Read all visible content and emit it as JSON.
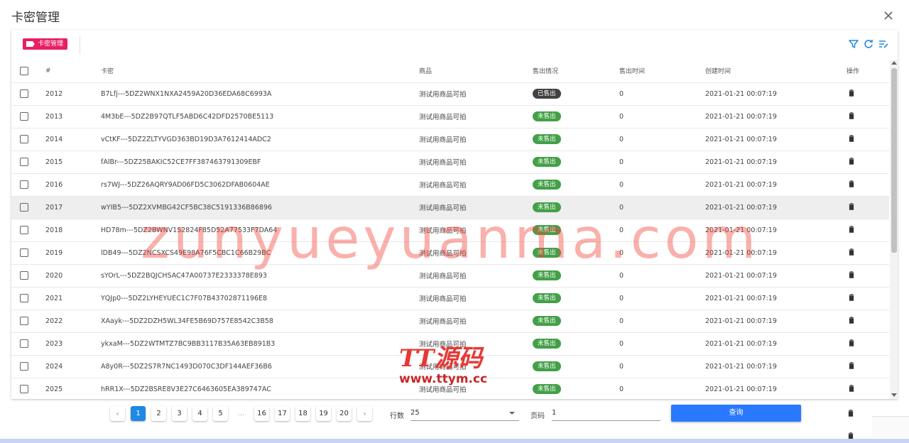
{
  "dialog": {
    "title": "卡密管理"
  },
  "toolbar": {
    "tag_label": "卡密管理"
  },
  "table": {
    "columns": [
      "#",
      "卡密",
      "商品",
      "售出情况",
      "售出时间",
      "创建时间",
      "操作"
    ],
    "rows": [
      {
        "id": "2012",
        "key": "B7Lfj---5DZ2WNX1NXA2459A20D36EDA68C6993A",
        "product": "测试用商品可拍",
        "status": "已售出",
        "sold": true,
        "sold_time": "0",
        "created": "2021-01-21 00:07:19"
      },
      {
        "id": "2013",
        "key": "4M3bE---5DZ2B97QTLF5ABD6C42DFD2570BE5113",
        "product": "测试用商品可拍",
        "status": "未售出",
        "sold": false,
        "sold_time": "0",
        "created": "2021-01-21 00:07:19"
      },
      {
        "id": "2014",
        "key": "vCtKF---5DZ2ZLTYVGD363BD19D3A7612414ADC2",
        "product": "测试用商品可拍",
        "status": "未售出",
        "sold": false,
        "sold_time": "0",
        "created": "2021-01-21 00:07:19"
      },
      {
        "id": "2015",
        "key": "fAlBr---5DZ25BAKIC52CE7FF387463791309EBF",
        "product": "测试用商品可拍",
        "status": "未售出",
        "sold": false,
        "sold_time": "0",
        "created": "2021-01-21 00:07:19"
      },
      {
        "id": "2016",
        "key": "rs7WJ---5DZ26AQRY9AD06FD5C3062DFAB0604AE",
        "product": "测试用商品可拍",
        "status": "未售出",
        "sold": false,
        "sold_time": "0",
        "created": "2021-01-21 00:07:19"
      },
      {
        "id": "2017",
        "key": "wYIB5---5DZ2XVMBG42CF5BC38C5191336B86896",
        "product": "测试用商品可拍",
        "status": "未售出",
        "sold": false,
        "sold_time": "0",
        "created": "2021-01-21 00:07:19",
        "highlight": true
      },
      {
        "id": "2018",
        "key": "HD78m---5DZ2BWNV1S2824F85D52A77533F7DA64",
        "product": "测试用商品可拍",
        "status": "未售出",
        "sold": false,
        "sold_time": "0",
        "created": "2021-01-21 00:07:19"
      },
      {
        "id": "2019",
        "key": "lDB49---5DZ2NCSXCS49E98A76F5CBC1C66B29BC",
        "product": "测试用商品可拍",
        "status": "未售出",
        "sold": false,
        "sold_time": "0",
        "created": "2021-01-21 00:07:19"
      },
      {
        "id": "2020",
        "key": "sYOrL---5DZ2BQJCHSAC47A00737E2333378E893",
        "product": "测试用商品可拍",
        "status": "未售出",
        "sold": false,
        "sold_time": "0",
        "created": "2021-01-21 00:07:19"
      },
      {
        "id": "2021",
        "key": "YQJp0---5DZ2LYHEYUEC1C7F07B43702871196E8",
        "product": "测试用商品可拍",
        "status": "未售出",
        "sold": false,
        "sold_time": "0",
        "created": "2021-01-21 00:07:19"
      },
      {
        "id": "2022",
        "key": "XAayk---5DZ2DZH5WL34FE5B69D757E8542C3B58",
        "product": "测试用商品可拍",
        "status": "未售出",
        "sold": false,
        "sold_time": "0",
        "created": "2021-01-21 00:07:19"
      },
      {
        "id": "2023",
        "key": "ykxaM---5DZ2WTMTZ7BC9BB3117B35A63EB891B3",
        "product": "测试用商品可拍",
        "status": "未售出",
        "sold": false,
        "sold_time": "0",
        "created": "2021-01-21 00:07:19"
      },
      {
        "id": "2024",
        "key": "A8y0R---5DZ2S7R7NC1493D070C3DF144AEF36B6",
        "product": "测试用商品可拍",
        "status": "未售出",
        "sold": false,
        "sold_time": "0",
        "created": "2021-01-21 00:07:19"
      },
      {
        "id": "2025",
        "key": "hRR1X---5DZ2BSRE8V3E27C6463605EA389747AC",
        "product": "测试用商品可拍",
        "status": "未售出",
        "sold": false,
        "sold_time": "0",
        "created": "2021-01-21 00:07:19"
      }
    ]
  },
  "pagination": {
    "prev_label": "‹",
    "next_label": "›",
    "pages": [
      "1",
      "2",
      "3",
      "4",
      "5",
      "…",
      "16",
      "17",
      "18",
      "19",
      "20"
    ],
    "current": "1",
    "rows_label": "行数",
    "rows_value": "25",
    "page_label": "页码",
    "page_value": "1",
    "query_label": "查询"
  },
  "watermark": {
    "text": "zunyueyuanma.com",
    "logo_text": "TT源码",
    "logo_url": "www.ttym.cc"
  },
  "colors": {
    "accent": "#2979ff",
    "tag": "#e91e63",
    "sold": "#424242",
    "unsold": "#43a047"
  },
  "icons": [
    "close-icon",
    "filter-icon",
    "refresh-icon",
    "sort-icon",
    "delete-icon",
    "tag-icon"
  ]
}
